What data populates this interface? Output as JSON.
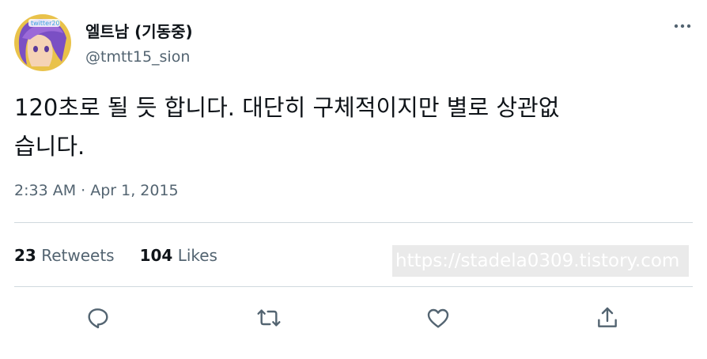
{
  "author": {
    "display_name": "엘트남 (기동중)",
    "handle": "@tmtt15_sion",
    "avatar_badge": "twitter20"
  },
  "tweet": {
    "text_line1": "120초로 될 듯 합니다. 대단히 구체적이지만 별로 상관없",
    "text_line2": "습니다.",
    "timestamp": "2:33 AM · Apr 1, 2015"
  },
  "stats": {
    "retweets_count": "23",
    "retweets_label": "Retweets",
    "likes_count": "104",
    "likes_label": "Likes"
  },
  "watermark": "https://stadela0309.tistory.com",
  "actions": {
    "reply_icon": "reply-icon",
    "retweet_icon": "retweet-icon",
    "like_icon": "heart-icon",
    "share_icon": "share-icon"
  },
  "colors": {
    "text": "#0f1419",
    "secondary": "#536471",
    "divider": "#cfd9de"
  }
}
